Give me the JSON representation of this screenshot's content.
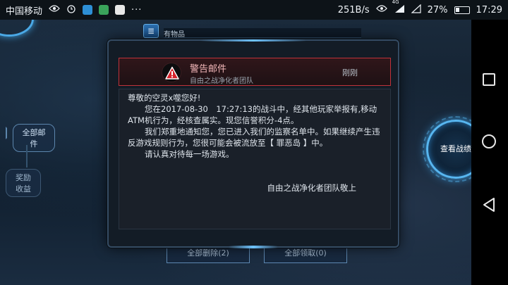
{
  "statusbar": {
    "carrier": "中国移动",
    "icons": [
      "visibility-icon",
      "alarm-icon",
      "app-icon-blue",
      "app-icon-green",
      "app-icon-map",
      "more-dots-icon"
    ],
    "more_dots": "···",
    "net_speed": "251B/s",
    "network_badge": "4G",
    "battery_percent": "27%",
    "battery_level": 0.27,
    "time": "17:29"
  },
  "background": {
    "tab_title": "有物品",
    "tab_icon_glyph": "≣",
    "tabs": [
      {
        "label": "全部邮件"
      },
      {
        "label": "奖励收益"
      }
    ],
    "bottom_buttons": [
      {
        "label": "全部删除(2)"
      },
      {
        "label": "全部领取(0)"
      }
    ],
    "stats_button": "查看战绩"
  },
  "mail": {
    "title": "警告邮件",
    "sender": "自由之战净化者团队",
    "time": "刚刚",
    "greeting": "尊敬的空灵x噬您好!",
    "paragraph1": "您在2017-08-30　17:27:13的战斗中，经其他玩家举报有,移动ATM机行为，经核查属实。现您信誉积分-4点。",
    "paragraph2": "我们郑重地通知您，您已进入我们的监察名单中。如果继续产生违反游戏规则行为，您很可能会被流放至【 罪恶岛 】中。",
    "paragraph3": "请认真对待每一场游戏。",
    "signature": "自由之战净化者团队敬上",
    "warning_color": "#c0323a"
  },
  "navbar": {
    "keys": [
      "recent-apps",
      "home",
      "back"
    ]
  }
}
